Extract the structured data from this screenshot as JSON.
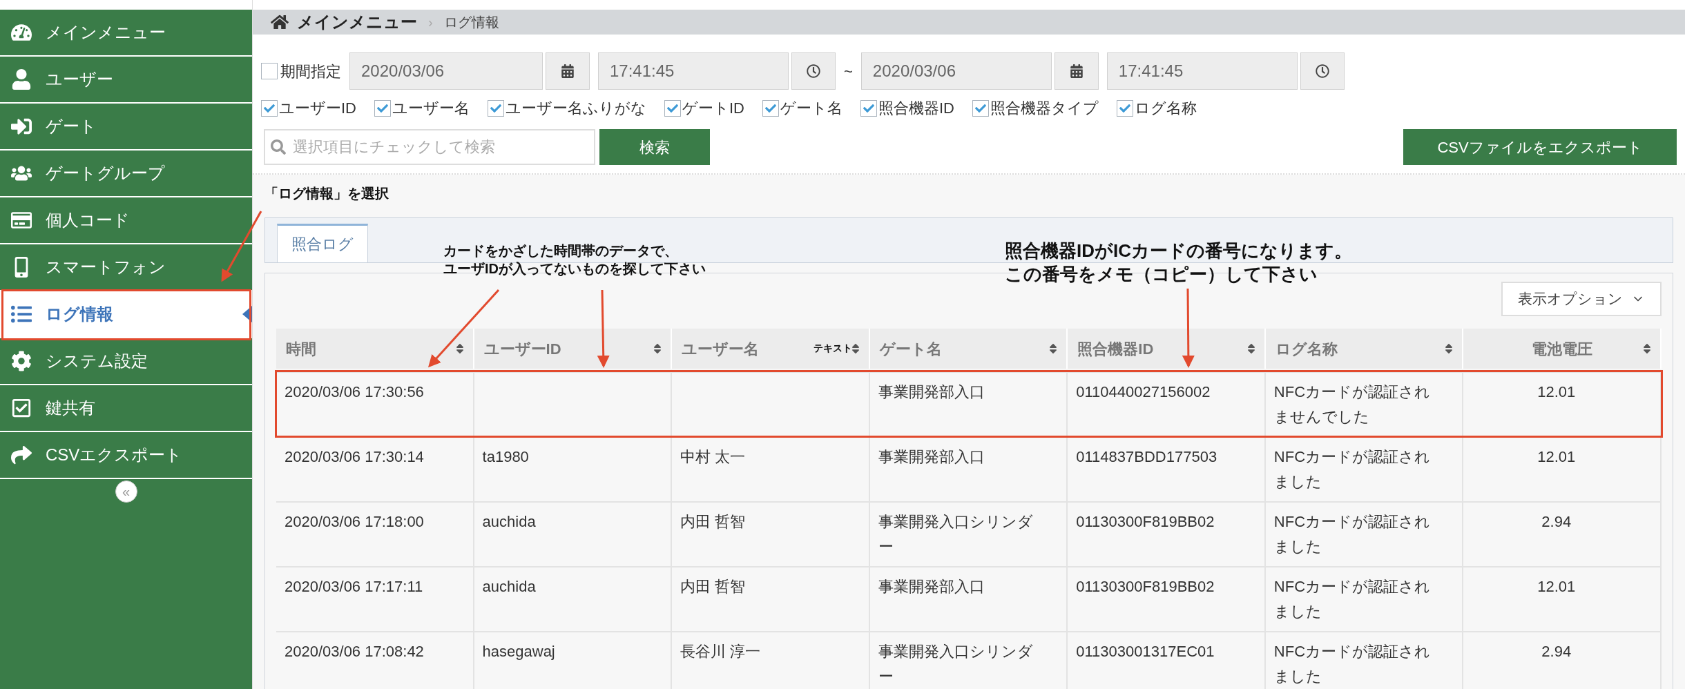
{
  "sidebar": {
    "items": [
      {
        "label": "メインメニュー",
        "selected": false,
        "highlighted": false
      },
      {
        "label": "ユーザー",
        "selected": false,
        "highlighted": false
      },
      {
        "label": "ゲート",
        "selected": false,
        "highlighted": false
      },
      {
        "label": "ゲートグループ",
        "selected": false,
        "highlighted": false
      },
      {
        "label": "個人コード",
        "selected": false,
        "highlighted": false
      },
      {
        "label": "スマートフォン",
        "selected": false,
        "highlighted": false
      },
      {
        "label": "ログ情報",
        "selected": true,
        "highlighted": true
      },
      {
        "label": "システム設定",
        "selected": false,
        "highlighted": false
      },
      {
        "label": "鍵共有",
        "selected": false,
        "highlighted": false
      },
      {
        "label": "CSVエクスポート",
        "selected": false,
        "highlighted": false
      }
    ],
    "collapse_button": "«"
  },
  "breadcrumb": {
    "home": "メインメニュー",
    "separator": "›",
    "current": "ログ情報"
  },
  "filters": {
    "period": {
      "label": "期間指定",
      "checked": false
    },
    "from_date": "2020/03/06",
    "from_time": "17:41:45",
    "range_separator": "~",
    "to_date": "2020/03/06",
    "to_time": "17:41:45",
    "fields": [
      {
        "label": "ユーザーID",
        "checked": true
      },
      {
        "label": "ユーザー名",
        "checked": true
      },
      {
        "label": "ユーザー名ふりがな",
        "checked": true
      },
      {
        "label": "ゲートID",
        "checked": true
      },
      {
        "label": "ゲート名",
        "checked": true
      },
      {
        "label": "照合機器ID",
        "checked": true
      },
      {
        "label": "照合機器タイプ",
        "checked": true
      },
      {
        "label": "ログ名称",
        "checked": true
      }
    ],
    "search_placeholder": "選択項目にチェックして検索",
    "search_button": "検索",
    "export_button": "CSVファイルをエクスポート"
  },
  "tabs": [
    {
      "label": "照合ログ",
      "selected": true
    }
  ],
  "display_options": "表示オプション",
  "table": {
    "columns": [
      {
        "label": "時間"
      },
      {
        "label": "ユーザーID"
      },
      {
        "label": "ユーザー名"
      },
      {
        "label": "ゲート名"
      },
      {
        "label": "照合機器ID"
      },
      {
        "label": "ログ名称"
      },
      {
        "label": "電池電圧"
      }
    ],
    "rows": [
      {
        "highlighted": true,
        "cells": [
          "2020/03/06 17:30:56",
          "",
          "",
          "事業開発部入口",
          "0110440027156002",
          "NFCカードが認証されませんでした",
          "12.01"
        ]
      },
      {
        "highlighted": false,
        "cells": [
          "2020/03/06 17:30:14",
          "ta1980",
          "中村 太一",
          "事業開発部入口",
          "0114837BDD177503",
          "NFCカードが認証されました",
          "12.01"
        ]
      },
      {
        "highlighted": false,
        "cells": [
          "2020/03/06 17:18:00",
          "auchida",
          "内田 哲智",
          "事業開発入口シリンダー",
          "01130300F819BB02",
          "NFCカードが認証されました",
          "2.94"
        ]
      },
      {
        "highlighted": false,
        "cells": [
          "2020/03/06 17:17:11",
          "auchida",
          "内田 哲智",
          "事業開発部入口",
          "01130300F819BB02",
          "NFCカードが認証されました",
          "12.01"
        ]
      },
      {
        "highlighted": false,
        "cells": [
          "2020/03/06 17:08:42",
          "hasegawaj",
          "長谷川 淳一",
          "事業開発入口シリンダー",
          "011303001317EC01",
          "NFCカードが認証されました",
          "2.94"
        ]
      }
    ]
  },
  "annotations": {
    "select_note": "「ログ情報」を選択",
    "callouts": [
      {
        "lines": [
          "カードをかざした時間帯のデータで、",
          "ユーザIDが入ってないものを探して下さい"
        ]
      },
      {
        "lines": [
          "照合機器IDがICカードの番号になります。",
          "この番号をメモ（コピー）して下さい"
        ]
      }
    ],
    "stray_text": "テキスト"
  }
}
